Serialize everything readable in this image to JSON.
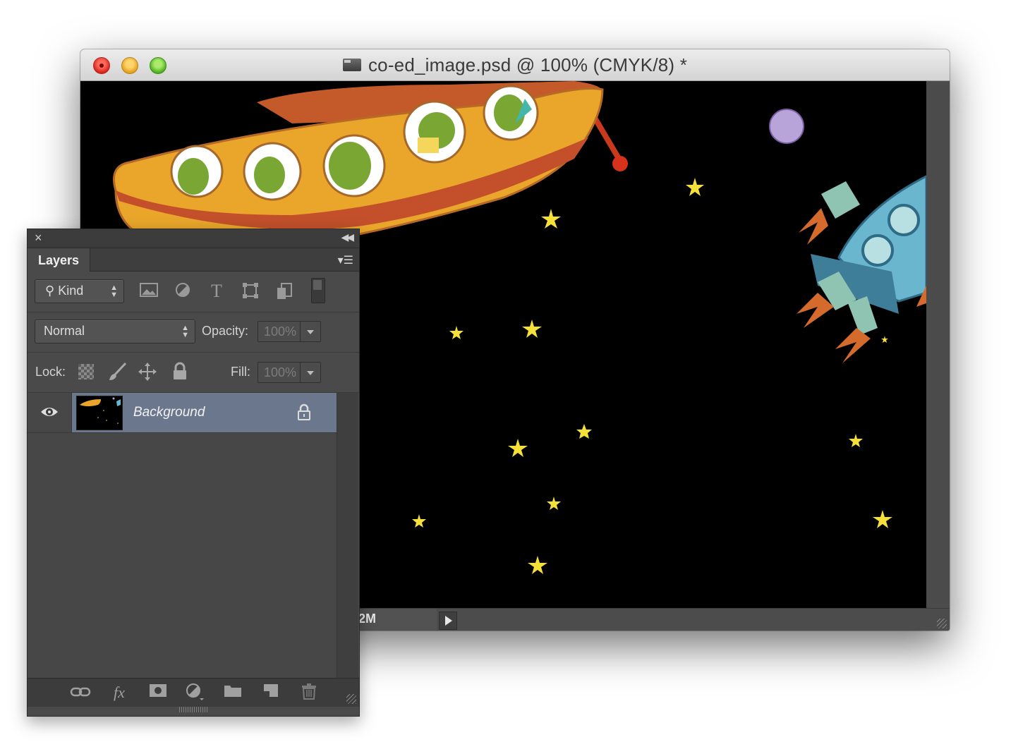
{
  "window": {
    "title": "co-ed_image.psd @ 100% (CMYK/8) *",
    "status_doc_size": "2M"
  },
  "layers_panel": {
    "tab_label": "Layers",
    "filter_kind_label": "Kind",
    "filter_icons": [
      "image-filter-icon",
      "adjustment-filter-icon",
      "type-filter-icon",
      "shape-filter-icon",
      "smart-object-filter-icon"
    ],
    "blend_mode": "Normal",
    "opacity_label": "Opacity:",
    "opacity_value": "100%",
    "lock_label": "Lock:",
    "fill_label": "Fill:",
    "fill_value": "100%",
    "layers": [
      {
        "name": "Background",
        "visible": true,
        "locked": true,
        "selected": true
      }
    ],
    "footer_icons": [
      "link-layers-icon",
      "fx-icon",
      "add-mask-icon",
      "adjustment-layer-icon",
      "new-group-icon",
      "new-layer-icon",
      "trash-icon"
    ],
    "fx_text": "fx"
  },
  "colors": {
    "canvas_background": "#000000",
    "selected_layer": "#6a778d",
    "panel_background": "#4a4a4a",
    "star": "#f5e03a",
    "ship_body": "#e8a52c",
    "rocket_body": "#6bb6cf"
  }
}
